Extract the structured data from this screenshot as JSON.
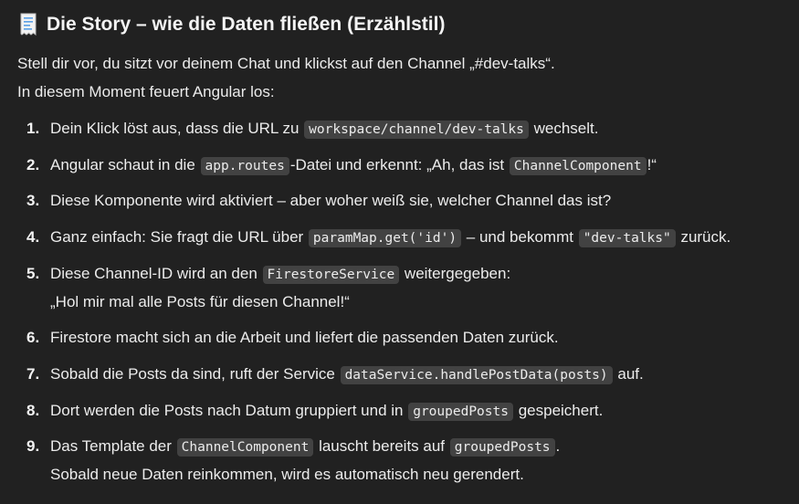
{
  "heading": {
    "emoji_icon": "receipt-icon",
    "title": "Die Story – wie die Daten fließen (Erzählstil)"
  },
  "intro": {
    "line1": "Stell dir vor, du sitzt vor deinem Chat und klickst auf den Channel „#dev-talks“.",
    "line2": "In diesem Moment feuert Angular los:"
  },
  "steps": [
    {
      "num": "1.",
      "a": "Dein Klick löst aus, dass die URL zu ",
      "c1": "workspace/channel/dev-talks",
      "b": " wechselt."
    },
    {
      "num": "2.",
      "a": "Angular schaut in die ",
      "c1": "app.routes",
      "b": "-Datei und erkennt: „Ah, das ist ",
      "c2": "ChannelComponent",
      "d": "!“"
    },
    {
      "num": "3.",
      "a": "Diese Komponente wird aktiviert – aber woher weiß sie, welcher Channel das ist?"
    },
    {
      "num": "4.",
      "a": "Ganz einfach: Sie fragt die URL über ",
      "c1": "paramMap.get('id')",
      "b": " – und bekommt ",
      "c2": "\"dev-talks\"",
      "d": " zurück."
    },
    {
      "num": "5.",
      "a": "Diese Channel-ID wird an den ",
      "c1": "FirestoreService",
      "b": " weitergegeben:",
      "line2": "„Hol mir mal alle Posts für diesen Channel!“"
    },
    {
      "num": "6.",
      "a": "Firestore macht sich an die Arbeit und liefert die passenden Daten zurück."
    },
    {
      "num": "7.",
      "a": "Sobald die Posts da sind, ruft der Service ",
      "c1": "dataService.handlePostData(posts)",
      "b": " auf."
    },
    {
      "num": "8.",
      "a": "Dort werden die Posts nach Datum gruppiert und in ",
      "c1": "groupedPosts",
      "b": " gespeichert."
    },
    {
      "num": "9.",
      "a": "Das Template der ",
      "c1": "ChannelComponent",
      "b": " lauscht bereits auf ",
      "c2": "groupedPosts",
      "d": ".",
      "line2": "Sobald neue Daten reinkommen, wird es automatisch neu gerendert."
    }
  ]
}
